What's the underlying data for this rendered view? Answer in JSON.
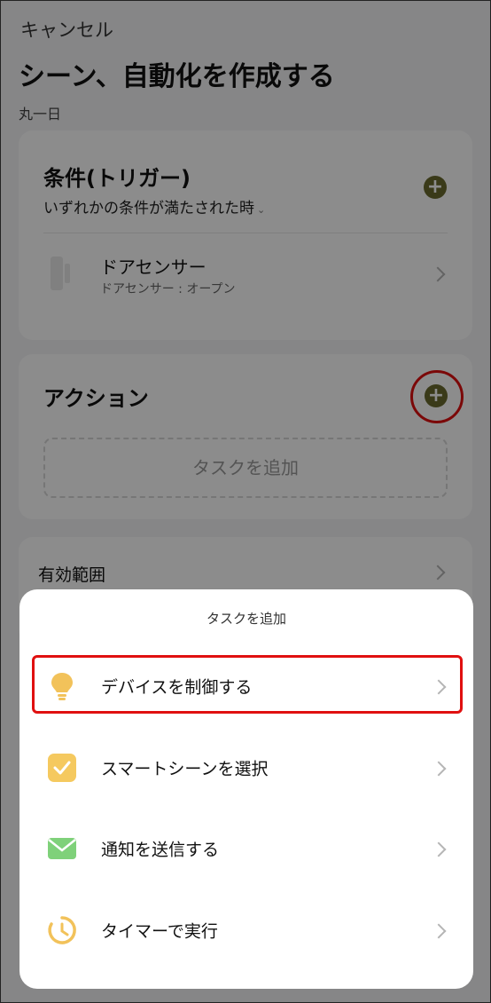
{
  "header": {
    "cancel_label": "キャンセル",
    "title": "シーン、自動化を作成する",
    "subtitle": "丸一日"
  },
  "condition": {
    "title": "条件(トリガー)",
    "match_mode": "いずれかの条件が満たされた時",
    "device": {
      "name": "ドアセンサー",
      "state": "ドアセンサー : オープン"
    }
  },
  "action": {
    "title": "アクション",
    "add_task_placeholder": "タスクを追加"
  },
  "scope": {
    "label": "有効範囲"
  },
  "sheet": {
    "title": "タスクを追加",
    "items": [
      {
        "label": "デバイスを制御する",
        "icon": "lightbulb-icon",
        "color": "#f2c25a"
      },
      {
        "label": "スマートシーンを選択",
        "icon": "checkbox-icon",
        "color": "#f5c95f"
      },
      {
        "label": "通知を送信する",
        "icon": "envelope-icon",
        "color": "#7fd17a"
      },
      {
        "label": "タイマーで実行",
        "icon": "timer-icon",
        "color": "#f2c25a"
      }
    ]
  },
  "colors": {
    "accent": "#d8d24a",
    "highlight": "#e01010"
  }
}
